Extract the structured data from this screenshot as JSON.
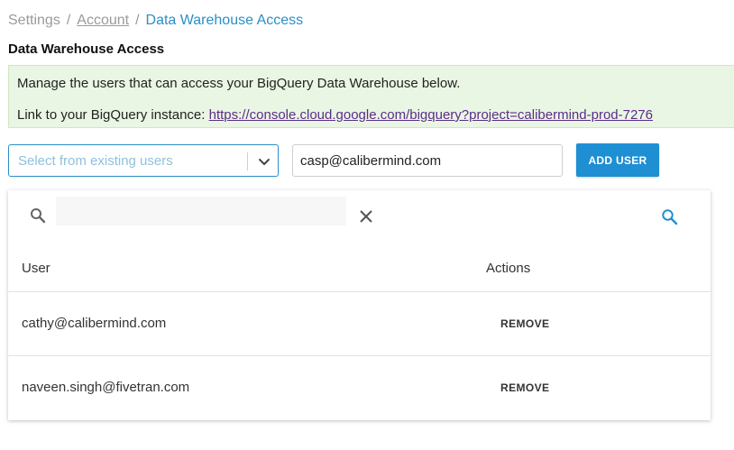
{
  "breadcrumb": {
    "items": [
      "Settings",
      "Account",
      "Data Warehouse Access"
    ],
    "separator": "/"
  },
  "page": {
    "title": "Data Warehouse Access"
  },
  "info": {
    "line1": "Manage the users that can access your BigQuery Data Warehouse below.",
    "line2_prefix": "Link to your BigQuery instance: ",
    "link_text": "https://console.cloud.google.com/bigquery?project=calibermind-prod-7276"
  },
  "form": {
    "select_placeholder": "Select from existing users",
    "email_value": "casp@calibermind.com",
    "add_button_label": "ADD USER"
  },
  "table": {
    "columns": [
      "User",
      "Actions"
    ],
    "rows": [
      {
        "user": "cathy@calibermind.com",
        "action": "REMOVE"
      },
      {
        "user": "naveen.singh@fivetran.com",
        "action": "REMOVE"
      }
    ]
  },
  "colors": {
    "accent": "#2b8fc6",
    "button": "#1e8fd3",
    "info_background": "#eaf6e4",
    "link": "#5a2d8a"
  },
  "icons": {
    "search_left": "search-icon",
    "clear": "close-icon",
    "search_right": "search-icon",
    "dropdown": "chevron-down-icon"
  }
}
